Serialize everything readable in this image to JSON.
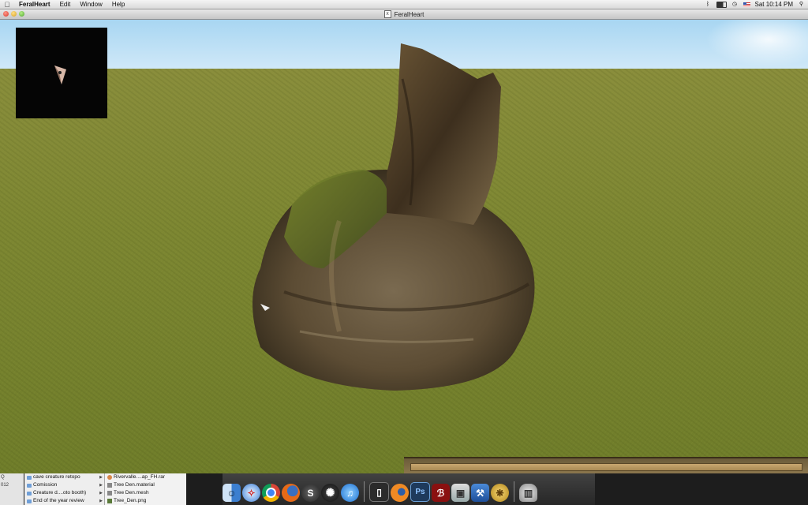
{
  "menubar": {
    "apple_icon": "apple-icon",
    "items": [
      "FeralHeart",
      "Edit",
      "Window",
      "Help"
    ],
    "clock": "Sat 10:14 PM",
    "status_icons": [
      "bluetooth-icon",
      "battery-icon",
      "time-machine-icon",
      "flag-icon",
      "spotlight-icon"
    ]
  },
  "window": {
    "title": "FeralHeart"
  },
  "finder": {
    "col1": [
      "Q",
      "012",
      "",
      ""
    ],
    "col2": [
      "cave creature retopo",
      "Comission",
      "Creature d....oto booth)",
      "End of the year review"
    ],
    "col3": [
      "Rivervalle....ap_FH.rar",
      "Tree Den.material",
      "Tree Den.mesh",
      "Tree_Den.png"
    ]
  },
  "dock": {
    "icons": [
      "finder-icon",
      "safari-icon",
      "chrome-icon",
      "firefox-icon",
      "skype-icon",
      "aperture-icon",
      "itunes-icon",
      "terminal-icon",
      "blender-icon",
      "photoshop-icon",
      "pdf-icon",
      "preview-icon",
      "xcode-icon",
      "gold-app-icon",
      "trash-icon"
    ]
  },
  "colors": {
    "sky": "#a8d6f2",
    "grass": "#7d8732",
    "rock": "#6b5a3e"
  }
}
